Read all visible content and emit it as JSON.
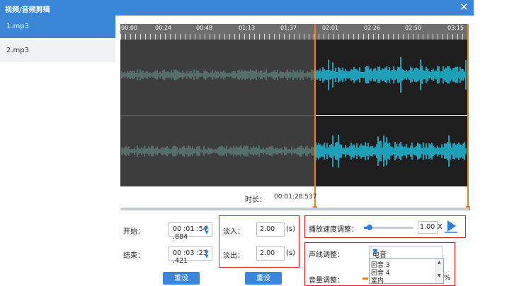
{
  "window": {
    "title": "视频/音频剪辑",
    "close_icon": "close-icon"
  },
  "sidebar": {
    "items": [
      {
        "label": "1.mp3",
        "active": true
      },
      {
        "label": "2.mp3",
        "active": false
      }
    ]
  },
  "timeline": {
    "ticks": [
      "00:00",
      "00:24",
      "00:48",
      "01:13",
      "01:37",
      "02:01",
      "02:26",
      "02:50",
      "03:15"
    ]
  },
  "duration": {
    "label": "时长：",
    "value": "00:01:28.537"
  },
  "trim": {
    "start_label": "开始：",
    "start_value": "00 :01 :54 .884",
    "end_label": "结束：",
    "end_value": "00 :03 :23 .421",
    "reset_label": "重设"
  },
  "fade": {
    "fade_in_label": "淡入：",
    "fade_in_value": "2.00",
    "fade_out_label": "淡出：",
    "fade_out_value": "2.00",
    "unit": "(s)",
    "reset_label": "重设"
  },
  "speed": {
    "label": "播放速度调整：",
    "value": "1.00",
    "unit": "X",
    "level": 0.12
  },
  "voice": {
    "label": "声线调整：",
    "selected": "电音",
    "options": [
      "回音 3",
      "回音 4",
      "室内"
    ]
  },
  "volume": {
    "label": "音量调整：",
    "unit": "%"
  },
  "colors": {
    "accent": "#3a86d8",
    "waveform_selected": "#1fc1e0",
    "waveform_unselected": "#5d7a76",
    "marker": "#f07e1a",
    "highlight_box": "#e0201a"
  }
}
